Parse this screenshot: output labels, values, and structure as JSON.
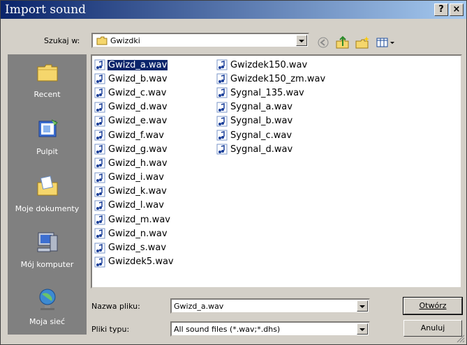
{
  "window": {
    "title": "Import sound"
  },
  "titlebar_buttons": {
    "help": "?",
    "close": "×"
  },
  "lookin": {
    "label": "Szukaj w:",
    "value": "Gwizdki"
  },
  "places": [
    {
      "label": "Recent",
      "icon": "folder-icon"
    },
    {
      "label": "Pulpit",
      "icon": "desktop-icon"
    },
    {
      "label": "Moje dokumenty",
      "icon": "documents-icon"
    },
    {
      "label": "Mój komputer",
      "icon": "computer-icon"
    },
    {
      "label": "Moja sieć",
      "icon": "network-icon"
    }
  ],
  "files": {
    "column1": [
      "Gwizd_a.wav",
      "Gwizd_b.wav",
      "Gwizd_c.wav",
      "Gwizd_d.wav",
      "Gwizd_e.wav",
      "Gwizd_f.wav",
      "Gwizd_g.wav",
      "Gwizd_h.wav",
      "Gwizd_i.wav",
      "Gwizd_k.wav",
      "Gwizd_l.wav",
      "Gwizd_m.wav",
      "Gwizd_n.wav",
      "Gwizd_s.wav",
      "Gwizdek5.wav"
    ],
    "column2": [
      "Gwizdek150.wav",
      "Gwizdek150_zm.wav",
      "Sygnal_135.wav",
      "Sygnal_a.wav",
      "Sygnal_b.wav",
      "Sygnal_c.wav",
      "Sygnal_d.wav"
    ],
    "selected": "Gwizd_a.wav"
  },
  "filename": {
    "label": "Nazwa pliku:",
    "value": "Gwizd_a.wav"
  },
  "filetype": {
    "label": "Pliki typu:",
    "value": "All sound files (*.wav;*.dhs)"
  },
  "buttons": {
    "open": "Otwórz",
    "cancel": "Anuluj"
  }
}
